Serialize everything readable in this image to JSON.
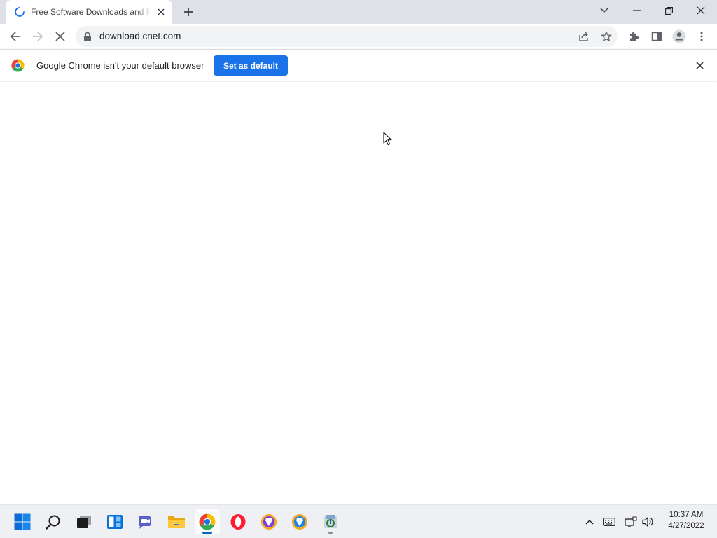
{
  "browser": {
    "tab": {
      "title": "Free Software Downloads and Reviews",
      "loading": true
    },
    "new_tab_icon": "plus-icon",
    "window_controls": [
      "tab-search-icon",
      "minimize-icon",
      "restore-icon",
      "close-icon"
    ],
    "toolbar": {
      "url": "download.cnet.com",
      "icons": [
        "back-arrow-icon",
        "forward-arrow-icon",
        "stop-icon",
        "lock-icon",
        "share-icon",
        "bookmark-star-icon",
        "extensions-puzzle-icon",
        "side-panel-icon",
        "profile-avatar-icon",
        "kebab-menu-icon"
      ]
    },
    "infobar": {
      "message": "Google Chrome isn't your default browser",
      "button_label": "Set as default"
    }
  },
  "taskbar": {
    "apps": [
      "windows-start-icon",
      "search-icon",
      "task-view-icon",
      "widgets-icon",
      "chat-icon",
      "file-explorer-icon",
      "chrome-icon",
      "opera-icon",
      "brave-icon",
      "brave-beta-icon",
      "installer-icon"
    ],
    "tray": [
      "chevron-up-icon",
      "keyboard-icon",
      "network-icon",
      "volume-icon"
    ],
    "clock": {
      "time": "10:37 AM",
      "date": "4/27/2022"
    }
  },
  "colors": {
    "accent": "#1a73e8",
    "tabstrip": "#dee1e6",
    "taskbar_accent": "#0067c0"
  }
}
